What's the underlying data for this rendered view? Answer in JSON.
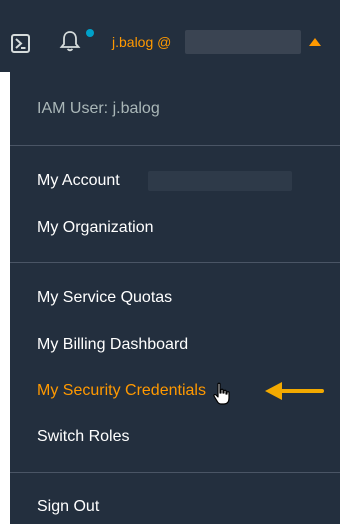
{
  "header": {
    "user_label": "j.balog @",
    "icons": [
      "cloudshell-icon",
      "bell-icon",
      "notification-dot",
      "caret-up-icon"
    ],
    "colors": {
      "bar": "#232f3e",
      "accent": "#ff9900",
      "dot": "#00a1c9"
    }
  },
  "menu": {
    "user_info": "IAM User: j.balog",
    "account": "My Account",
    "organization": "My Organization",
    "service_quotas": "My Service Quotas",
    "billing_dashboard": "My Billing Dashboard",
    "security_credentials": "My Security Credentials",
    "switch_roles": "Switch Roles",
    "sign_out": "Sign Out"
  },
  "annotations": {
    "arrow_icon": "left-arrow-icon",
    "cursor_icon": "pointer-hand-icon",
    "arrow_color": "#f2a900"
  }
}
